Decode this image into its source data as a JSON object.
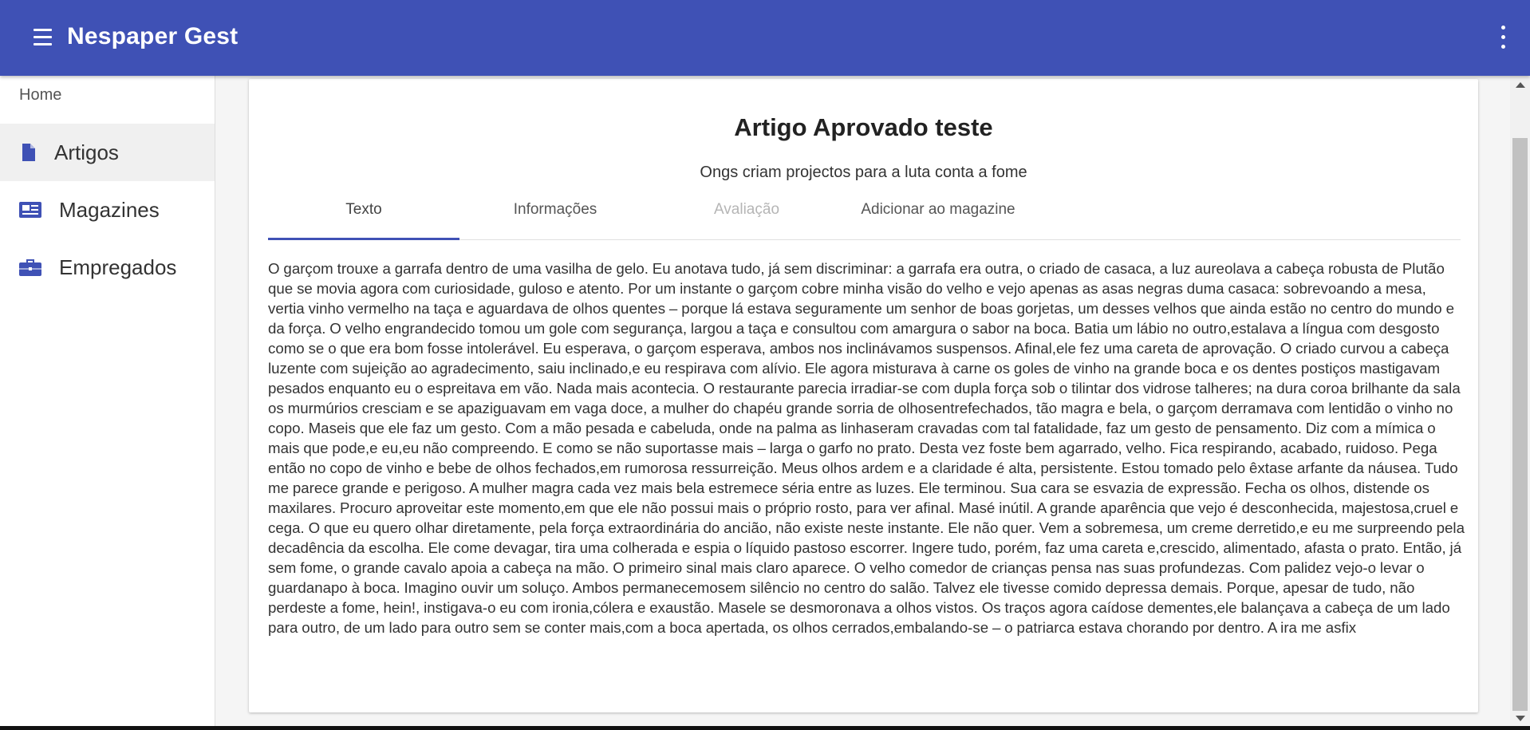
{
  "app": {
    "title": "Nespaper Gest"
  },
  "colors": {
    "primary": "#3f51b5",
    "sidebar_icon": "#3f51b5"
  },
  "icons": {
    "menu": "hamburger-menu-icon",
    "more": "more-vert-icon",
    "artigos": "document-icon",
    "magazines": "newspaper-icon",
    "empregados": "briefcase-icon"
  },
  "sidebar": {
    "home": "Home",
    "items": [
      {
        "label": "Artigos",
        "active": true
      },
      {
        "label": "Magazines",
        "active": false
      },
      {
        "label": "Empregados",
        "active": false
      }
    ]
  },
  "article": {
    "title": "Artigo Aprovado teste",
    "subtitle": "Ongs criam projectos para a luta conta a fome",
    "tabs": [
      {
        "label": "Texto",
        "state": "active"
      },
      {
        "label": "Informações",
        "state": "enabled"
      },
      {
        "label": "Avaliação",
        "state": "disabled"
      },
      {
        "label": "Adicionar ao magazine",
        "state": "enabled"
      }
    ],
    "body": "O garçom trouxe a garrafa dentro de uma vasilha de gelo. Eu anotava tudo, já sem discriminar: a garrafa era outra, o criado de casaca, a luz aureolava a cabeça robusta de Plutão que se movia agora com curiosidade, guloso e atento. Por um instante o garçom cobre minha visão do velho e vejo apenas as asas negras duma casaca: sobrevoando a mesa, vertia vinho vermelho na taça e aguardava de olhos quentes – porque lá estava seguramente um senhor de boas gorjetas, um desses velhos que ainda estão no centro do mundo e da força. O velho engrandecido tomou um gole com segurança, largou a taça e consultou com amargura o sabor na boca. Batia um lábio no outro,estalava a língua com desgosto como se o que era bom fosse intolerável. Eu esperava, o garçom esperava, ambos nos inclinávamos suspensos. Afinal,ele fez uma careta de aprovação. O criado curvou a cabeça luzente com sujeição ao agradecimento, saiu inclinado,e eu respirava com alívio. Ele agora misturava à carne os goles de vinho na grande boca e os dentes postiços mastigavam pesados enquanto eu o espreitava em vão. Nada mais acontecia. O restaurante parecia irradiar-se com dupla força sob o tilintar dos vidrose talheres; na dura coroa brilhante da sala os murmúrios cresciam e se apaziguavam em vaga doce, a mulher do chapéu grande sorria de olhosentrefechados, tão magra e bela, o garçom derramava com lentidão o vinho no copo. Maseis que ele faz um gesto. Com a mão pesada e cabeluda, onde na palma as linhaseram cravadas com tal fatalidade, faz um gesto de pensamento. Diz com a mímica o mais que pode,e eu,eu não compreendo. E como se não suportasse mais – larga o garfo no prato. Desta vez foste bem agarrado, velho. Fica respirando, acabado, ruidoso. Pega então no copo de vinho e bebe de olhos fechados,em rumorosa ressurreição. Meus olhos ardem e a claridade é alta, persistente. Estou tomado pelo êxtase arfante da náusea. Tudo me parece grande e perigoso. A mulher magra cada vez mais bela estremece séria entre as luzes. Ele terminou. Sua cara se esvazia de expressão. Fecha os olhos, distende os maxilares. Procuro aproveitar este momento,em que ele não possui mais o próprio rosto, para ver afinal. Masé inútil. A grande aparência que vejo é desconhecida, majestosa,cruel e cega. O que eu quero olhar diretamente, pela força extraordinária do ancião, não existe neste instante. Ele não quer. Vem a sobremesa, um creme derretido,e eu me surpreendo pela decadência da escolha. Ele come devagar, tira uma colherada e espia o líquido pastoso escorrer. Ingere tudo, porém, faz uma careta e,crescido, alimentado, afasta o prato. Então, já sem fome, o grande cavalo apoia a cabeça na mão. O primeiro sinal mais claro aparece. O velho comedor de crianças pensa nas suas profundezas. Com palidez vejo-o levar o guardanapo à boca. Imagino ouvir um soluço. Ambos permanecemosem silêncio no centro do salão. Talvez ele tivesse comido depressa demais. Porque, apesar de tudo, não perdeste a fome, hein!, instigava-o eu com ironia,cólera e exaustão. Masele se desmoronava a olhos vistos. Os traços agora caídose dementes,ele balançava a cabeça de um lado para outro, de um lado para outro sem se conter mais,com a boca apertada, os olhos cerrados,embalando-se – o patriarca estava chorando por dentro. A ira me asfix"
  }
}
